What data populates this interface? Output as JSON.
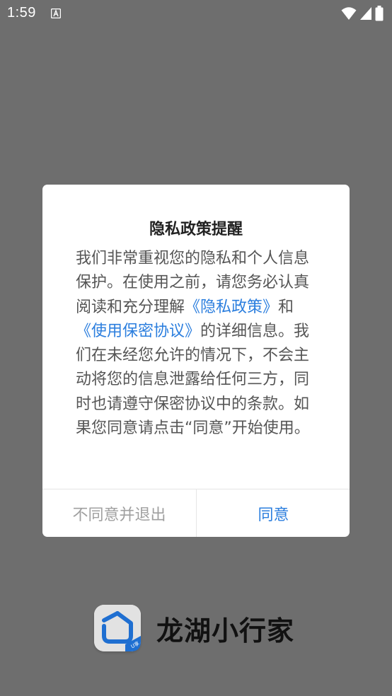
{
  "status_bar": {
    "time": "1:59"
  },
  "dialog": {
    "title": "隐私政策提醒",
    "body_part1": "我们非常重视您的隐私和个人信息保护。在使用之前，请您务必认真阅读和充分理解",
    "privacy_link": "《隐私政策》",
    "body_part2": "和",
    "agreement_link": "《使用保密协议》",
    "body_part3": "的详细信息。我们在未经您允许的情况下，不会主动将您的信息泄露给任何三方，同时也请遵守保密协议中的条款。如果您同意请点击“同意”开始使用。",
    "decline_label": "不同意并退出",
    "agree_label": "同意"
  },
  "branding": {
    "app_name": "龙湖小行家",
    "logo_badge": "U享"
  },
  "colors": {
    "overlay": "#6e6e6e",
    "link": "#2b7ede",
    "decline_text": "#a0a0a0",
    "logo_blue": "#1f6fd1"
  }
}
